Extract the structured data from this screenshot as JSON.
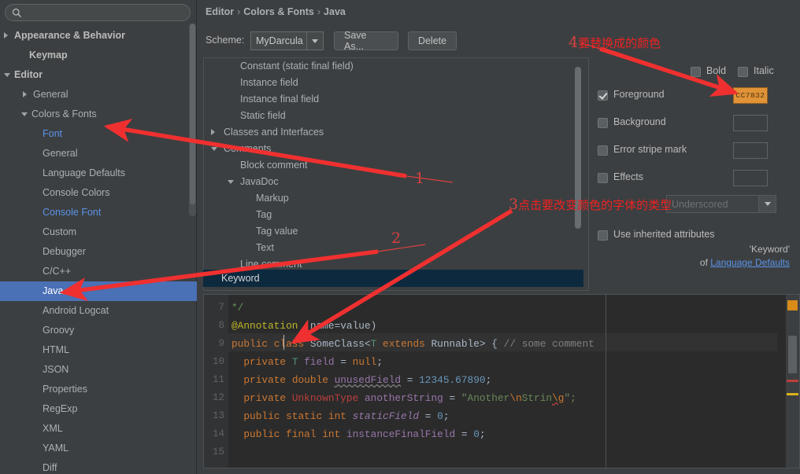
{
  "search": {
    "placeholder": "",
    "value": "",
    "icon": "search-icon"
  },
  "sidebar": {
    "items": [
      {
        "label": "Appearance & Behavior",
        "indent": 18,
        "arrow": "closed",
        "bold": true,
        "style": "plain"
      },
      {
        "label": "Keymap",
        "indent": 37,
        "arrow": "none",
        "bold": true,
        "style": "plain"
      },
      {
        "label": "Editor",
        "indent": 18,
        "arrow": "open",
        "bold": true,
        "style": "plain"
      },
      {
        "label": "General",
        "indent": 42,
        "arrow": "closed",
        "bold": false,
        "style": "plain"
      },
      {
        "label": "Colors & Fonts",
        "indent": 40,
        "arrow": "open",
        "bold": false,
        "style": "plain"
      },
      {
        "label": "Font",
        "indent": 54,
        "arrow": "none",
        "bold": false,
        "style": "blue"
      },
      {
        "label": "General",
        "indent": 54,
        "arrow": "none",
        "bold": false,
        "style": "plain"
      },
      {
        "label": "Language Defaults",
        "indent": 54,
        "arrow": "none",
        "bold": false,
        "style": "plain"
      },
      {
        "label": "Console Colors",
        "indent": 54,
        "arrow": "none",
        "bold": false,
        "style": "plain"
      },
      {
        "label": "Console Font",
        "indent": 54,
        "arrow": "none",
        "bold": false,
        "style": "blue"
      },
      {
        "label": "Custom",
        "indent": 54,
        "arrow": "none",
        "bold": false,
        "style": "plain"
      },
      {
        "label": "Debugger",
        "indent": 54,
        "arrow": "none",
        "bold": false,
        "style": "plain"
      },
      {
        "label": "C/C++",
        "indent": 54,
        "arrow": "none",
        "bold": false,
        "style": "plain"
      },
      {
        "label": "Java",
        "indent": 54,
        "arrow": "none",
        "bold": false,
        "style": "plain",
        "selected": true
      },
      {
        "label": "Android Logcat",
        "indent": 54,
        "arrow": "none",
        "bold": false,
        "style": "plain"
      },
      {
        "label": "Groovy",
        "indent": 54,
        "arrow": "none",
        "bold": false,
        "style": "plain"
      },
      {
        "label": "HTML",
        "indent": 54,
        "arrow": "none",
        "bold": false,
        "style": "plain"
      },
      {
        "label": "JSON",
        "indent": 54,
        "arrow": "none",
        "bold": false,
        "style": "plain"
      },
      {
        "label": "Properties",
        "indent": 54,
        "arrow": "none",
        "bold": false,
        "style": "plain"
      },
      {
        "label": "RegExp",
        "indent": 54,
        "arrow": "none",
        "bold": false,
        "style": "plain"
      },
      {
        "label": "XML",
        "indent": 54,
        "arrow": "none",
        "bold": false,
        "style": "plain"
      },
      {
        "label": "YAML",
        "indent": 54,
        "arrow": "none",
        "bold": false,
        "style": "plain"
      },
      {
        "label": "Diff",
        "indent": 54,
        "arrow": "none",
        "bold": false,
        "style": "plain"
      }
    ]
  },
  "breadcrumb": {
    "items": [
      "Editor",
      "Colors & Fonts",
      "Java"
    ],
    "separator": "›"
  },
  "toolbar": {
    "scheme_label": "Scheme:",
    "scheme_value": "MyDarcula",
    "save_as_label": "Save As...",
    "delete_label": "Delete"
  },
  "attributes_tree": {
    "items": [
      {
        "label": "Constant (static final field)",
        "indent": 46,
        "arrow": "none"
      },
      {
        "label": "Instance field",
        "indent": 46,
        "arrow": "none"
      },
      {
        "label": "Instance final field",
        "indent": 46,
        "arrow": "none"
      },
      {
        "label": "Static field",
        "indent": 46,
        "arrow": "none"
      },
      {
        "label": "Classes and Interfaces",
        "indent": 25,
        "arrow": "closed"
      },
      {
        "label": "Comments",
        "indent": 25,
        "arrow": "open"
      },
      {
        "label": "Block comment",
        "indent": 46,
        "arrow": "none"
      },
      {
        "label": "JavaDoc",
        "indent": 46,
        "arrow": "open"
      },
      {
        "label": "Markup",
        "indent": 66,
        "arrow": "none"
      },
      {
        "label": "Tag",
        "indent": 66,
        "arrow": "none"
      },
      {
        "label": "Tag value",
        "indent": 66,
        "arrow": "none"
      },
      {
        "label": "Text",
        "indent": 66,
        "arrow": "none"
      },
      {
        "label": "Line comment",
        "indent": 46,
        "arrow": "none"
      }
    ],
    "selected_item": "Keyword"
  },
  "attributes_panel": {
    "bold": {
      "label": "Bold",
      "checked": false
    },
    "italic": {
      "label": "Italic",
      "checked": false
    },
    "foreground": {
      "label": "Foreground",
      "checked": true,
      "color": "CC7832",
      "color_hex": "#cc7832"
    },
    "background": {
      "label": "Background",
      "checked": false,
      "color": ""
    },
    "error_stripe": {
      "label": "Error stripe mark",
      "checked": false,
      "color": ""
    },
    "effects": {
      "label": "Effects",
      "checked": false,
      "color": ""
    },
    "effects_type": "Underscored",
    "use_inherited": {
      "label": "Use inherited attributes",
      "checked": false
    },
    "inherit_note_line1": "'Keyword'",
    "inherit_note_of": "of ",
    "inherit_note_link": "Language Defaults"
  },
  "preview": {
    "line_numbers": [
      "7",
      "8",
      "9",
      "10",
      "11",
      "12",
      "13",
      "14",
      "15"
    ],
    "lines": [
      {
        "n": "7",
        "text": "*/"
      },
      {
        "n": "8",
        "text": "@Annotation (name=value)"
      },
      {
        "n": "9",
        "text": "public class SomeClass<T extends Runnable> { // some comment"
      },
      {
        "n": "10",
        "text": "  private T field = null;"
      },
      {
        "n": "11",
        "text": "  private double unusedField = 12345.67890;"
      },
      {
        "n": "12",
        "text": "  private UnknownType anotherString = \"Another\\nStrin\\g\";"
      },
      {
        "n": "13",
        "text": "  public static int staticField = 0;"
      },
      {
        "n": "14",
        "text": "  public final int instanceFinalField = 0;"
      },
      {
        "n": "15",
        "text": ""
      }
    ]
  },
  "annotations": {
    "mark1": {
      "num": "1",
      "text": ""
    },
    "mark2": {
      "num": "2",
      "text": ""
    },
    "mark3": {
      "num": "3",
      "text": "点击要改变颜色的字体的类型"
    },
    "mark4": {
      "num": "4",
      "text": "要替换成的颜色"
    },
    "color": "#ee2222"
  }
}
